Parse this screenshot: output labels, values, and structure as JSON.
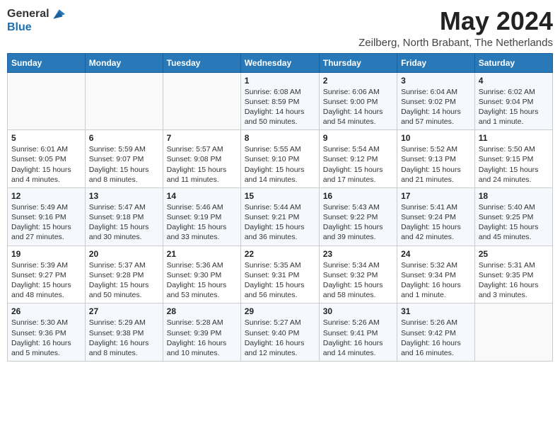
{
  "header": {
    "logo_general": "General",
    "logo_blue": "Blue",
    "month": "May 2024",
    "location": "Zeilberg, North Brabant, The Netherlands"
  },
  "days_of_week": [
    "Sunday",
    "Monday",
    "Tuesday",
    "Wednesday",
    "Thursday",
    "Friday",
    "Saturday"
  ],
  "weeks": [
    [
      {
        "day": "",
        "info": ""
      },
      {
        "day": "",
        "info": ""
      },
      {
        "day": "",
        "info": ""
      },
      {
        "day": "1",
        "info": "Sunrise: 6:08 AM\nSunset: 8:59 PM\nDaylight: 14 hours\nand 50 minutes."
      },
      {
        "day": "2",
        "info": "Sunrise: 6:06 AM\nSunset: 9:00 PM\nDaylight: 14 hours\nand 54 minutes."
      },
      {
        "day": "3",
        "info": "Sunrise: 6:04 AM\nSunset: 9:02 PM\nDaylight: 14 hours\nand 57 minutes."
      },
      {
        "day": "4",
        "info": "Sunrise: 6:02 AM\nSunset: 9:04 PM\nDaylight: 15 hours\nand 1 minute."
      }
    ],
    [
      {
        "day": "5",
        "info": "Sunrise: 6:01 AM\nSunset: 9:05 PM\nDaylight: 15 hours\nand 4 minutes."
      },
      {
        "day": "6",
        "info": "Sunrise: 5:59 AM\nSunset: 9:07 PM\nDaylight: 15 hours\nand 8 minutes."
      },
      {
        "day": "7",
        "info": "Sunrise: 5:57 AM\nSunset: 9:08 PM\nDaylight: 15 hours\nand 11 minutes."
      },
      {
        "day": "8",
        "info": "Sunrise: 5:55 AM\nSunset: 9:10 PM\nDaylight: 15 hours\nand 14 minutes."
      },
      {
        "day": "9",
        "info": "Sunrise: 5:54 AM\nSunset: 9:12 PM\nDaylight: 15 hours\nand 17 minutes."
      },
      {
        "day": "10",
        "info": "Sunrise: 5:52 AM\nSunset: 9:13 PM\nDaylight: 15 hours\nand 21 minutes."
      },
      {
        "day": "11",
        "info": "Sunrise: 5:50 AM\nSunset: 9:15 PM\nDaylight: 15 hours\nand 24 minutes."
      }
    ],
    [
      {
        "day": "12",
        "info": "Sunrise: 5:49 AM\nSunset: 9:16 PM\nDaylight: 15 hours\nand 27 minutes."
      },
      {
        "day": "13",
        "info": "Sunrise: 5:47 AM\nSunset: 9:18 PM\nDaylight: 15 hours\nand 30 minutes."
      },
      {
        "day": "14",
        "info": "Sunrise: 5:46 AM\nSunset: 9:19 PM\nDaylight: 15 hours\nand 33 minutes."
      },
      {
        "day": "15",
        "info": "Sunrise: 5:44 AM\nSunset: 9:21 PM\nDaylight: 15 hours\nand 36 minutes."
      },
      {
        "day": "16",
        "info": "Sunrise: 5:43 AM\nSunset: 9:22 PM\nDaylight: 15 hours\nand 39 minutes."
      },
      {
        "day": "17",
        "info": "Sunrise: 5:41 AM\nSunset: 9:24 PM\nDaylight: 15 hours\nand 42 minutes."
      },
      {
        "day": "18",
        "info": "Sunrise: 5:40 AM\nSunset: 9:25 PM\nDaylight: 15 hours\nand 45 minutes."
      }
    ],
    [
      {
        "day": "19",
        "info": "Sunrise: 5:39 AM\nSunset: 9:27 PM\nDaylight: 15 hours\nand 48 minutes."
      },
      {
        "day": "20",
        "info": "Sunrise: 5:37 AM\nSunset: 9:28 PM\nDaylight: 15 hours\nand 50 minutes."
      },
      {
        "day": "21",
        "info": "Sunrise: 5:36 AM\nSunset: 9:30 PM\nDaylight: 15 hours\nand 53 minutes."
      },
      {
        "day": "22",
        "info": "Sunrise: 5:35 AM\nSunset: 9:31 PM\nDaylight: 15 hours\nand 56 minutes."
      },
      {
        "day": "23",
        "info": "Sunrise: 5:34 AM\nSunset: 9:32 PM\nDaylight: 15 hours\nand 58 minutes."
      },
      {
        "day": "24",
        "info": "Sunrise: 5:32 AM\nSunset: 9:34 PM\nDaylight: 16 hours\nand 1 minute."
      },
      {
        "day": "25",
        "info": "Sunrise: 5:31 AM\nSunset: 9:35 PM\nDaylight: 16 hours\nand 3 minutes."
      }
    ],
    [
      {
        "day": "26",
        "info": "Sunrise: 5:30 AM\nSunset: 9:36 PM\nDaylight: 16 hours\nand 5 minutes."
      },
      {
        "day": "27",
        "info": "Sunrise: 5:29 AM\nSunset: 9:38 PM\nDaylight: 16 hours\nand 8 minutes."
      },
      {
        "day": "28",
        "info": "Sunrise: 5:28 AM\nSunset: 9:39 PM\nDaylight: 16 hours\nand 10 minutes."
      },
      {
        "day": "29",
        "info": "Sunrise: 5:27 AM\nSunset: 9:40 PM\nDaylight: 16 hours\nand 12 minutes."
      },
      {
        "day": "30",
        "info": "Sunrise: 5:26 AM\nSunset: 9:41 PM\nDaylight: 16 hours\nand 14 minutes."
      },
      {
        "day": "31",
        "info": "Sunrise: 5:26 AM\nSunset: 9:42 PM\nDaylight: 16 hours\nand 16 minutes."
      },
      {
        "day": "",
        "info": ""
      }
    ]
  ]
}
